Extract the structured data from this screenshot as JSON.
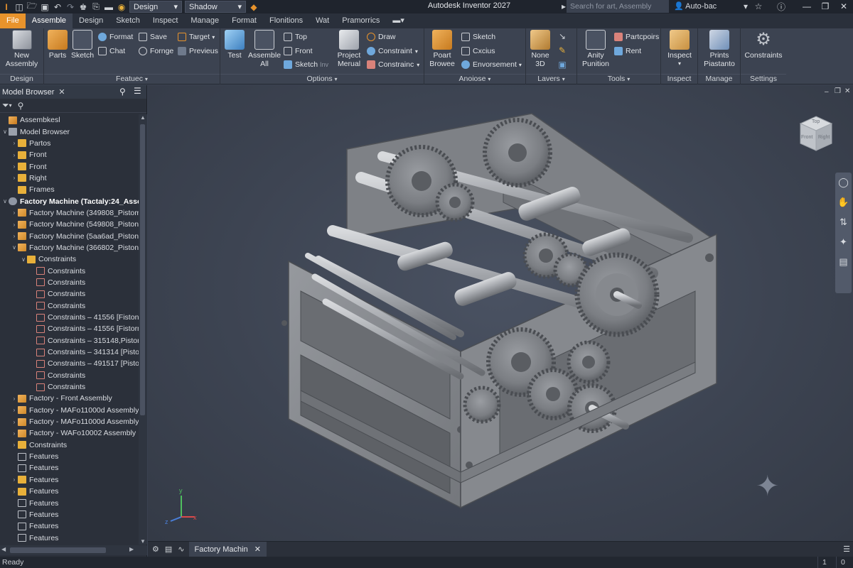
{
  "titlebar": {
    "workspace_combo": "Design",
    "visual_combo": "Shadow",
    "app_title": "Autodesk Inventor 2027",
    "search_placeholder": "Search for art, Assembly",
    "user": "Auto-bac"
  },
  "tabs": [
    "File",
    "Assemble",
    "Design",
    "Sketch",
    "Inspect",
    "Manage",
    "Format",
    "Flonitions",
    "Wat",
    "Pramorrics"
  ],
  "active_tab": "Assemble",
  "ribbon": {
    "design": {
      "new_assembly": "New\nAssembly",
      "label": "Design"
    },
    "features": {
      "parts": "Parts",
      "sketch": "Sketch",
      "format": "Format",
      "chat": "Chat",
      "save": "Save",
      "fornge": "Fornge",
      "target": "Target",
      "previeus": "Previeus",
      "label": "Featuec"
    },
    "options": {
      "test": "Test",
      "assemble_all": "Assemble\nAll",
      "top": "Top",
      "front": "Front",
      "sketch_inv": "Sketch",
      "sketch_inv_sub": "Inv",
      "project_merual": "Project\nMerual",
      "draw": "Draw",
      "constraint1": "Constraint",
      "constraint2": "Constrainc",
      "label": "Options"
    },
    "anoiose": {
      "poart_browee": "Poart\nBrowee",
      "sketch": "Sketch",
      "cxcius": "Cxcius",
      "envorsement": "Envorsement",
      "label": "Anoiose"
    },
    "lavers": {
      "none_3d": "None\n3D",
      "label": "Lavers"
    },
    "tools": {
      "anity_punition": "Anity\nPunition",
      "partcpoirs": "Partcpoirs",
      "rent": "Rent",
      "label": "Tools"
    },
    "inspect": {
      "inspect": "Inspect",
      "label": "Inspect"
    },
    "manage": {
      "prints_piastanto": "Prints\nPiastanto",
      "label": "Manage"
    },
    "settings": {
      "constraints": "Constraints",
      "label": "Settings"
    }
  },
  "browser": {
    "title": "Model Browser",
    "tree": [
      {
        "label": "Assembkesl",
        "level": 0,
        "caret": "",
        "icon": "assembly"
      },
      {
        "label": "Model Browser",
        "level": 0,
        "caret": "down",
        "icon": "list"
      },
      {
        "label": "Partos",
        "level": 1,
        "caret": "right",
        "icon": "folder"
      },
      {
        "label": "Front",
        "level": 1,
        "caret": "right",
        "icon": "folder"
      },
      {
        "label": "Front",
        "level": 1,
        "caret": "right",
        "icon": "folder"
      },
      {
        "label": "Right",
        "level": 1,
        "caret": "right",
        "icon": "folder"
      },
      {
        "label": "Frames",
        "level": 1,
        "caret": "",
        "icon": "folder"
      },
      {
        "label": "Factory Machine (Tactaly:24_Asser",
        "level": 0,
        "caret": "down",
        "icon": "gear",
        "bold": true
      },
      {
        "label": "Factory Machine (349808_Pistom)",
        "level": 1,
        "caret": "right",
        "icon": "part"
      },
      {
        "label": "Factory Machine (549808_Pistons",
        "level": 1,
        "caret": "right",
        "icon": "part"
      },
      {
        "label": "Factory Machine (5aa6ad_Pistons",
        "level": 1,
        "caret": "right",
        "icon": "part"
      },
      {
        "label": "Factory Machine (366802_Pistons",
        "level": 1,
        "caret": "down",
        "icon": "part"
      },
      {
        "label": "Constraints",
        "level": 2,
        "caret": "down",
        "icon": "folder"
      },
      {
        "label": "Constraints",
        "level": 3,
        "caret": "",
        "icon": "constraint"
      },
      {
        "label": "Constraints",
        "level": 3,
        "caret": "",
        "icon": "constraint"
      },
      {
        "label": "Constraints",
        "level": 3,
        "caret": "",
        "icon": "constraint"
      },
      {
        "label": "Constraints",
        "level": 3,
        "caret": "",
        "icon": "constraint"
      },
      {
        "label": "Constraints – 41556 [Fistonrl",
        "level": 3,
        "caret": "",
        "icon": "constraint"
      },
      {
        "label": "Constraints – 41556 [Fistorm",
        "level": 3,
        "caret": "",
        "icon": "constraint"
      },
      {
        "label": "Constraints – 315148,Pistons",
        "level": 3,
        "caret": "",
        "icon": "constraint"
      },
      {
        "label": "Constraints – 341314 [Pistom",
        "level": 3,
        "caret": "",
        "icon": "constraint"
      },
      {
        "label": "Constraints – 491517 [Pistom",
        "level": 3,
        "caret": "",
        "icon": "constraint"
      },
      {
        "label": "Constraints",
        "level": 3,
        "caret": "",
        "icon": "constraint"
      },
      {
        "label": "Constraints",
        "level": 3,
        "caret": "",
        "icon": "constraint"
      },
      {
        "label": "Factory - Front Assembly",
        "level": 1,
        "caret": "right",
        "icon": "part"
      },
      {
        "label": "Factory - MAFo11000d Assembly",
        "level": 1,
        "caret": "right",
        "icon": "part"
      },
      {
        "label": "Factory - MAFo11000d Assembly",
        "level": 1,
        "caret": "right",
        "icon": "part"
      },
      {
        "label": "Factory - WAFo10002 Assembly",
        "level": 1,
        "caret": "right",
        "icon": "part"
      },
      {
        "label": "Constraints",
        "level": 1,
        "caret": "right",
        "icon": "folder"
      },
      {
        "label": "Features",
        "level": 1,
        "caret": "",
        "icon": "table"
      },
      {
        "label": "Features",
        "level": 1,
        "caret": "",
        "icon": "table"
      },
      {
        "label": "Features",
        "level": 1,
        "caret": "right",
        "icon": "folder"
      },
      {
        "label": "Features",
        "level": 1,
        "caret": "right",
        "icon": "folder"
      },
      {
        "label": "Features",
        "level": 1,
        "caret": "",
        "icon": "table"
      },
      {
        "label": "Features",
        "level": 1,
        "caret": "",
        "icon": "table"
      },
      {
        "label": "Features",
        "level": 1,
        "caret": "",
        "icon": "table"
      },
      {
        "label": "Features",
        "level": 1,
        "caret": "",
        "icon": "table"
      }
    ]
  },
  "viewcube": {
    "top": "Top",
    "front": "Front",
    "right": "Right"
  },
  "axes": {
    "x": "x",
    "y": "y",
    "z": "z"
  },
  "document_tab": "Factory Machin",
  "status": {
    "text": "Ready",
    "right1": "1",
    "right2": "0"
  },
  "colors": {
    "accent": "#e8932c",
    "ribbon_bg": "#3c4351",
    "browser_bg": "#2b303a",
    "viewport_bg": "#3d4452",
    "metal": "#8a8d92"
  }
}
